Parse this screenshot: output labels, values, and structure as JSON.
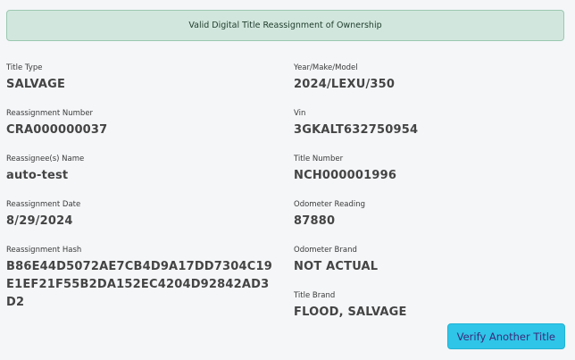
{
  "banner": {
    "text": "Valid Digital Title Reassignment of Ownership"
  },
  "left_fields": [
    {
      "label": "Title Type",
      "value": "SALVAGE"
    },
    {
      "label": "Reassignment Number",
      "value": "CRA000000037"
    },
    {
      "label": "Reassignee(s) Name",
      "value": "auto-test"
    },
    {
      "label": "Reassignment Date",
      "value": "8/29/2024"
    },
    {
      "label": "Reassignment Hash",
      "value": "B86E44D5072AE7CB4D9A17DD7304C19E1EF21F55B2DA152EC4204D92842AD3D2"
    }
  ],
  "right_fields": [
    {
      "label": "Year/Make/Model",
      "value": "2024/LEXU/350"
    },
    {
      "label": "Vin",
      "value": "3GKALT632750954"
    },
    {
      "label": "Title Number",
      "value": "NCH000001996"
    },
    {
      "label": "Odometer Reading",
      "value": "87880"
    },
    {
      "label": "Odometer Brand",
      "value": "NOT ACTUAL"
    },
    {
      "label": "Title Brand",
      "value": "FLOOD, SALVAGE"
    }
  ],
  "actions": {
    "verify_another_label": "Verify Another Title"
  },
  "colors": {
    "banner_bg": "#d1e7dd",
    "button_bg": "#2ec5e8"
  }
}
